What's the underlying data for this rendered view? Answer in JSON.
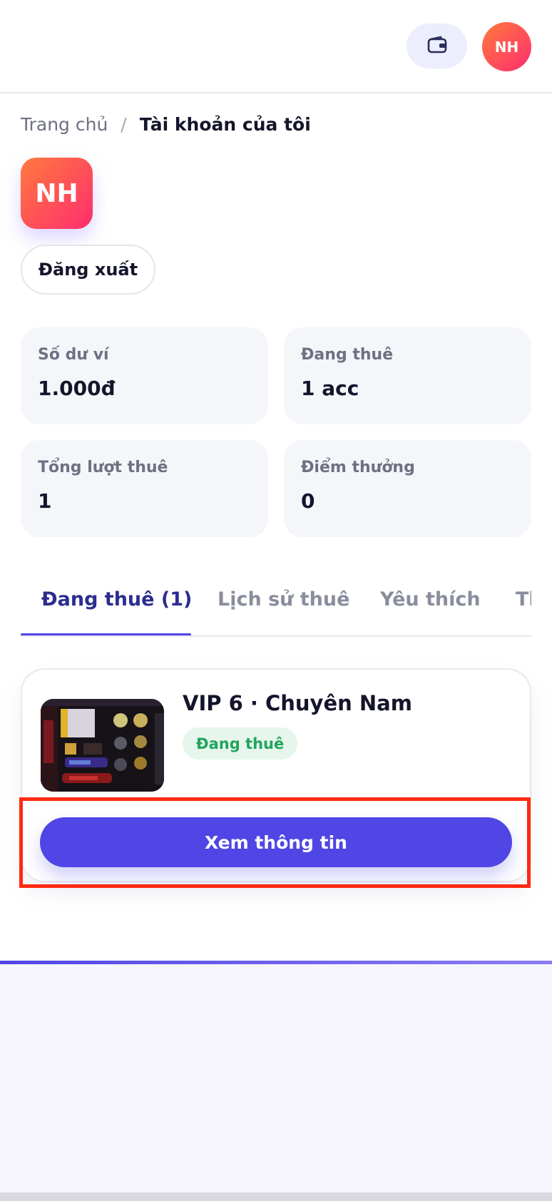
{
  "header": {
    "wallet_icon": "wallet-icon",
    "avatar_initials": "NH"
  },
  "breadcrumb": {
    "home": "Trang chủ",
    "separator": "/",
    "current": "Tài khoản của tôi"
  },
  "profile": {
    "avatar_initials": "NH",
    "logout_label": "Đăng xuất"
  },
  "stats": [
    {
      "label": "Số dư ví",
      "value": "1.000đ"
    },
    {
      "label": "Đang thuê",
      "value": "1 acc"
    },
    {
      "label": "Tổng lượt thuê",
      "value": "1"
    },
    {
      "label": "Điểm thưởng",
      "value": "0"
    }
  ],
  "tabs": [
    {
      "label": "Đang thuê (1)",
      "active": true
    },
    {
      "label": "Lịch sử thuê",
      "active": false
    },
    {
      "label": "Yêu thích",
      "active": false
    },
    {
      "label": "Th",
      "active": false
    }
  ],
  "rental": {
    "title": "VIP 6 · Chuyên Nam",
    "status": "Đang thuê",
    "button_label": "Xem thông tin"
  },
  "colors": {
    "accent": "#4f46e5",
    "avatar_gradient_start": "#ff7a3d",
    "avatar_gradient_end": "#ff2d6f",
    "status_green": "#22a45d",
    "highlight": "#ff2a12"
  }
}
